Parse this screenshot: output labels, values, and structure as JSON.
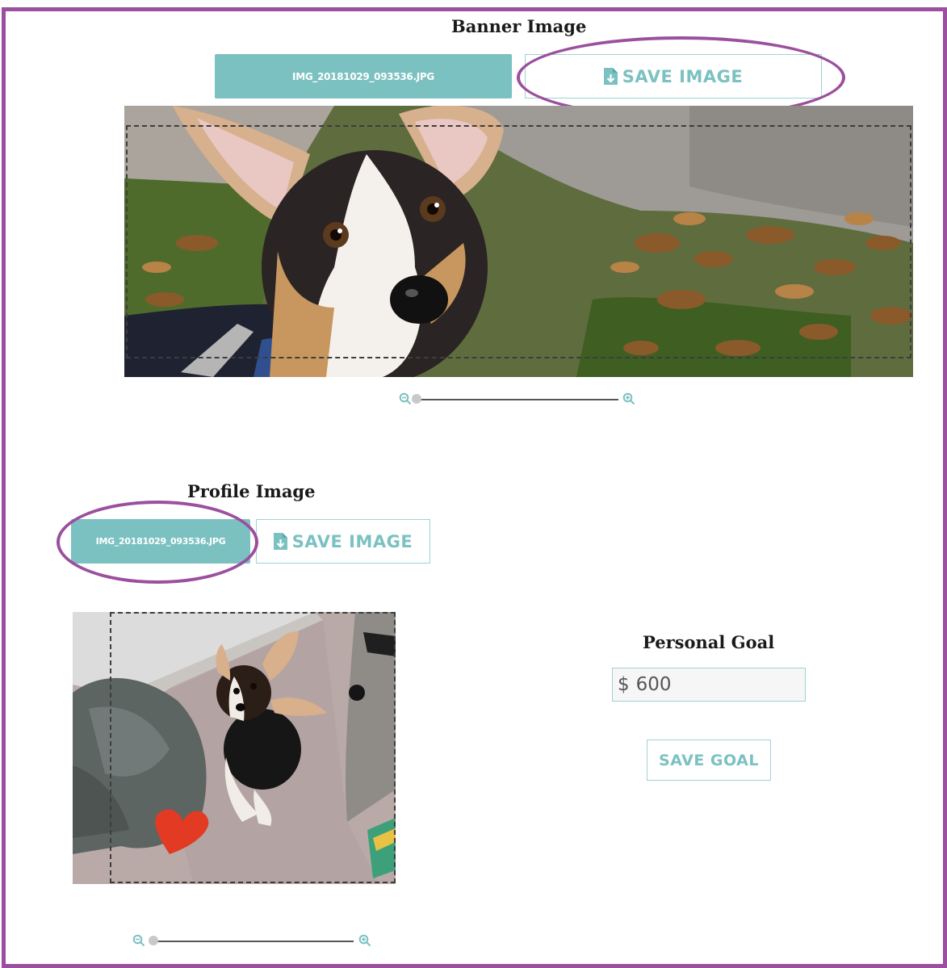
{
  "banner": {
    "heading": "Banner Image",
    "file_button_label": "IMG_20181029_093536.JPG",
    "save_button_label": "SAVE IMAGE",
    "photo_alt": "corgi in autumn leaves"
  },
  "profile": {
    "heading": "Profile Image",
    "file_button_label": "IMG_20181029_093536.JPG",
    "save_button_label": "SAVE IMAGE",
    "photo_alt": "corgi puppy sitting on office floor"
  },
  "goal": {
    "heading": "Personal Goal",
    "currency_symbol": "$",
    "amount_value": "600",
    "save_button_label": "SAVE GOAL"
  },
  "colors": {
    "accent": "#7cc1c1",
    "accent_border": "#9fd2d2",
    "annotation": "#9b4f9e"
  },
  "icons": {
    "save": "file-save-icon",
    "zoom_out": "zoom-out-icon",
    "zoom_in": "zoom-in-icon"
  }
}
